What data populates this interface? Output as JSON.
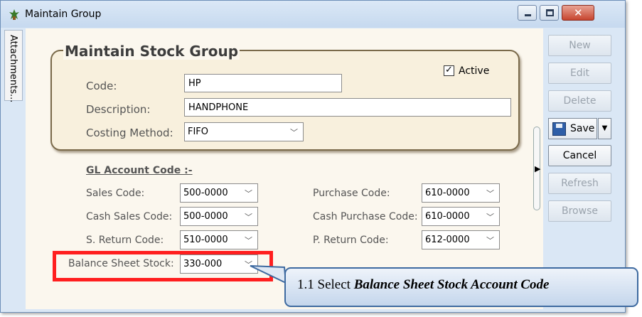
{
  "window": {
    "title": "Maintain Group"
  },
  "side_tab": {
    "label": "Attachments..."
  },
  "form": {
    "group_title": "Maintain Stock Group",
    "active_label": "Active",
    "active_checked": true,
    "code_label": "Code:",
    "code_value": "HP",
    "description_label": "Description:",
    "description_value": "HANDPHONE",
    "costing_label": "Costing Method:",
    "costing_value": "FIFO"
  },
  "gl": {
    "heading": "GL Account Code :-",
    "sales_label": "Sales Code:",
    "sales_value": "500-0000",
    "cash_sales_label": "Cash Sales Code:",
    "cash_sales_value": "500-0000",
    "s_return_label": "S. Return Code:",
    "s_return_value": "510-0000",
    "balance_sheet_label": "Balance Sheet Stock:",
    "balance_sheet_value": "330-000",
    "purchase_label": "Purchase Code:",
    "purchase_value": "610-0000",
    "cash_purchase_label": "Cash Purchase Code:",
    "cash_purchase_value": "610-0000",
    "p_return_label": "P. Return Code:",
    "p_return_value": "612-0000"
  },
  "buttons": {
    "new": "New",
    "edit": "Edit",
    "delete": "Delete",
    "save": "Save",
    "cancel": "Cancel",
    "refresh": "Refresh",
    "browse": "Browse"
  },
  "callout": {
    "prefix": "1.1 Select ",
    "emphasis": "Balance Sheet Stock Account Code"
  },
  "colors": {
    "highlight": "#ff1f1f",
    "callout_border": "#3e6aa0"
  },
  "icons": [
    "app-icon",
    "minimize-icon",
    "maximize-icon",
    "close-icon",
    "save-disk-icon",
    "chevron-down-icon",
    "checkmark-icon"
  ]
}
